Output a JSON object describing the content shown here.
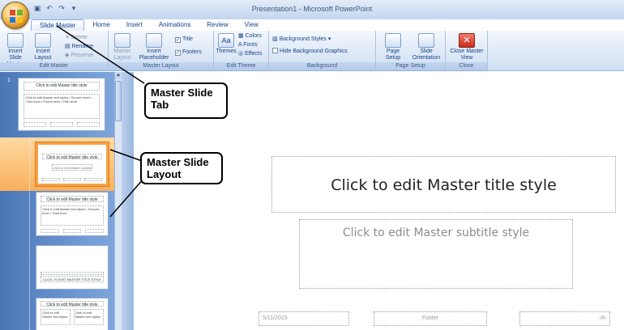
{
  "window": {
    "title_doc": "Presentation1",
    "title_sep": " - ",
    "title_app": "Microsoft PowerPoint"
  },
  "tabs": [
    "Slide Master",
    "Home",
    "Insert",
    "Animations",
    "Review",
    "View"
  ],
  "ribbon": {
    "edit_master": {
      "label": "Edit Master",
      "insert_slide_master": "Insert Slide Master",
      "insert_layout": "Insert Layout",
      "delete": "Delete",
      "rename": "Rename",
      "preserve": "Preserve"
    },
    "master_layout": {
      "label": "Master Layout",
      "master_layout_btn": "Master Layout",
      "insert_placeholder": "Insert Placeholder",
      "title_check": "Title",
      "footers_check": "Footers"
    },
    "edit_theme": {
      "label": "Edit Theme",
      "themes": "Themes",
      "colors": "Colors",
      "fonts": "Fonts",
      "effects": "Effects"
    },
    "background": {
      "label": "Background",
      "background_styles": "Background Styles",
      "hide_background_graphics": "Hide Background Graphics"
    },
    "page_setup": {
      "label": "Page Setup",
      "page_setup": "Page Setup",
      "slide_orientation": "Slide Orientation"
    },
    "close": {
      "label": "Close",
      "close_master_view": "Close Master View"
    }
  },
  "slide_pane": {
    "slide_number": "1",
    "thumbnails": [
      {
        "title": "Click to edit Master title style",
        "body": "Click to edit Master text styles\n• Second level\n • Third level\n  • Fourth level\n   • Fifth level"
      },
      {
        "title": "Click to edit Master title style",
        "sub": "Click to edit Master subtitle style"
      },
      {
        "title": "Click to edit Master title style",
        "body": "Click to edit Master text styles\n• Second level\n • Third level"
      },
      {
        "title": "CLICK TO EDIT MASTER TITLE STYLE",
        "body": ""
      },
      {
        "title": "Click to edit Master title style",
        "body": "Click to edit Master text styles"
      }
    ]
  },
  "callouts": {
    "tab": "Master Slide Tab",
    "layout": "Master Slide Layout"
  },
  "slide": {
    "title": "Click to edit Master title style",
    "subtitle": "Click to edit Master subtitle style",
    "date": "5/11/2015",
    "footer": "Footer",
    "number": "‹#›"
  }
}
